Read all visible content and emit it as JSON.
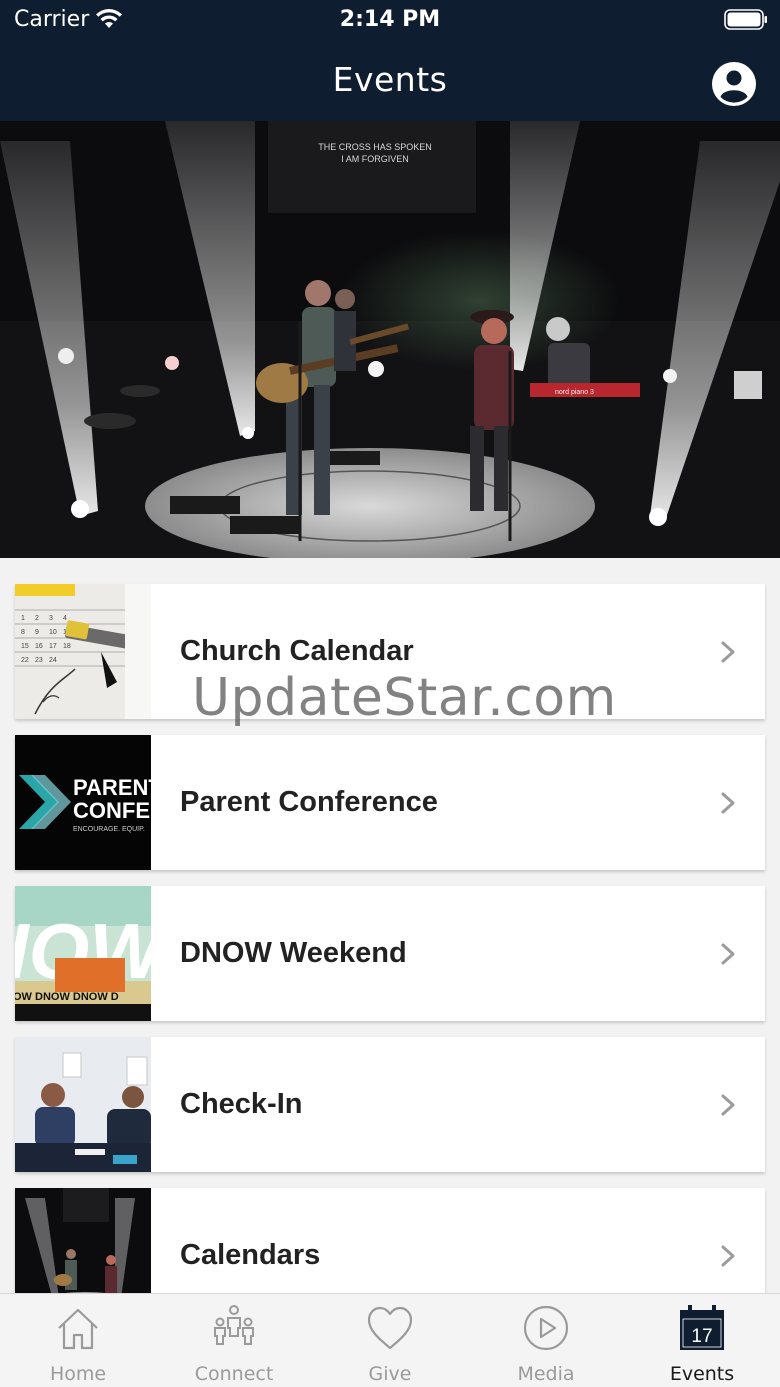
{
  "status_bar": {
    "carrier": "Carrier",
    "time": "2:14 PM"
  },
  "header": {
    "title": "Events"
  },
  "hero": {
    "screen_line1": "THE CROSS HAS SPOKEN",
    "screen_line2": "I AM FORGIVEN",
    "keyboard_label": "nord piano 3"
  },
  "events": [
    {
      "label": "Church Calendar",
      "thumb_text": ""
    },
    {
      "label": "Parent Conference",
      "thumb_line1": "PARENT",
      "thumb_line2": "CONFERE",
      "thumb_line3": "ENCOURAGE. EQUIP."
    },
    {
      "label": "DNOW Weekend",
      "thumb_big": "IOW",
      "thumb_repeat": "OW DNOW DNOW D"
    },
    {
      "label": "Check-In"
    },
    {
      "label": "Calendars"
    }
  ],
  "watermark": "UpdateStar.com",
  "tabs": [
    {
      "label": "Home",
      "icon": "home-icon",
      "active": false
    },
    {
      "label": "Connect",
      "icon": "people-icon",
      "active": false
    },
    {
      "label": "Give",
      "icon": "heart-icon",
      "active": false
    },
    {
      "label": "Media",
      "icon": "play-icon",
      "active": false
    },
    {
      "label": "Events",
      "icon": "calendar-icon",
      "active": true,
      "calendar_day": "17"
    }
  ],
  "colors": {
    "header_bg": "#0f1d30",
    "tab_inactive": "#9a9a9a",
    "tab_active": "#1a1a1a"
  }
}
